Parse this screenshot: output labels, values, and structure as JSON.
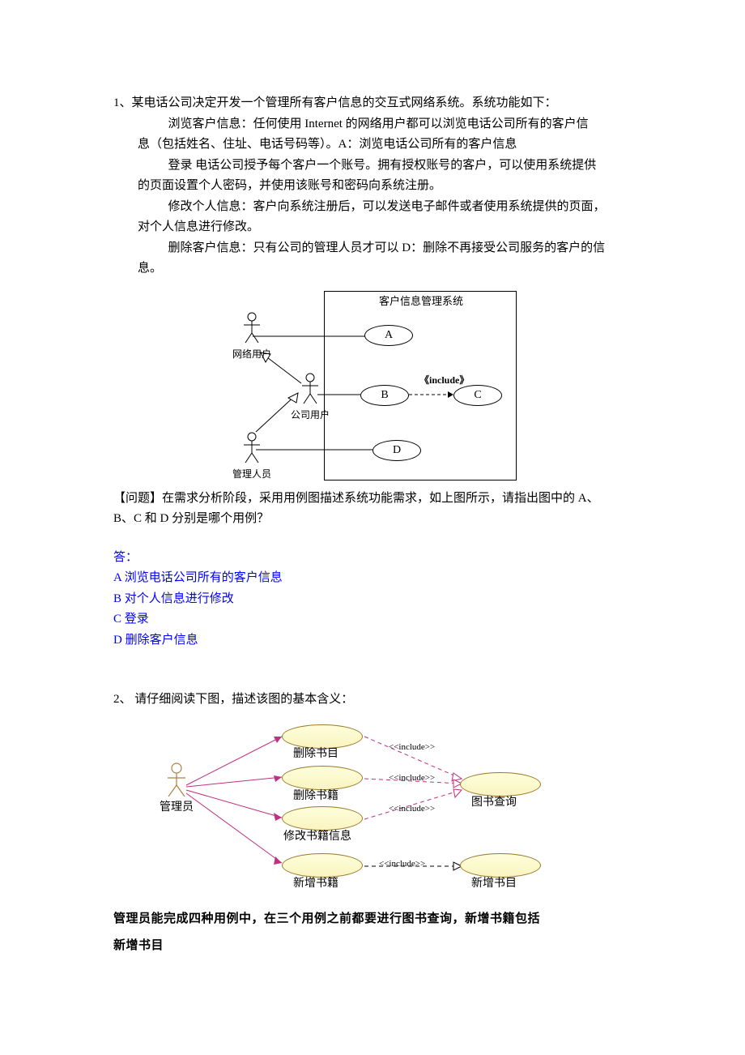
{
  "q1": {
    "prefix": "1、某电话公司决定开发一个管理所有客户信息的交互式网络系统。系统功能如下：",
    "p1": "浏览客户信息：任何使用 Internet 的网络用户都可以浏览电话公司所有的客户信",
    "p1b": "息（包括姓名、住址、电话号码等）。A：浏览电话公司所有的客户信息",
    "p2": "登录 电话公司授予每个客户一个账号。拥有授权账号的客户，可以使用系统提供",
    "p2b": "的页面设置个人密码，并使用该账号和密码向系统注册。",
    "p3": "修改个人信息：客户向系统注册后，可以发送电子邮件或者使用系统提供的页面，",
    "p3b": "对个人信息进行修改。",
    "p4": "删除客户信息：只有公司的管理人员才可以 D：删除不再接受公司服务的客户的信",
    "p4b": "息。",
    "diagram": {
      "title": "客户信息管理系统",
      "actor_network": "网络用户",
      "actor_company": "公司用户",
      "actor_admin": "管理人员",
      "ucA": "A",
      "ucB": "B",
      "ucC": "C",
      "ucD": "D",
      "include_label": "《include》"
    },
    "question_l1": "【问题】在需求分析阶段，采用用例图描述系统功能需求，如上图所示，请指出图中的 A、",
    "question_l2": "B、C 和 D 分别是哪个用例？",
    "answer_label": "答：",
    "answers": {
      "a": "A 浏览电话公司所有的客户信息",
      "b": "B 对个人信息进行修改",
      "c": "C 登录",
      "d": "D 删除客户信息"
    }
  },
  "q2": {
    "prefix": "2、 请仔细阅读下图，描述该图的基本含义：",
    "diagram": {
      "actor": "管理员",
      "uc1": "删除书目",
      "uc2": "删除书籍",
      "uc3": "修改书籍信息",
      "uc4": "新增书籍",
      "uc5": "图书查询",
      "uc6": "新增书目",
      "include": "<<include>>"
    },
    "conclusion_l1": "管理员能完成四种用例中，在三个用例之前都要进行图书查询，新增书籍包括",
    "conclusion_l2": "新增书目"
  }
}
